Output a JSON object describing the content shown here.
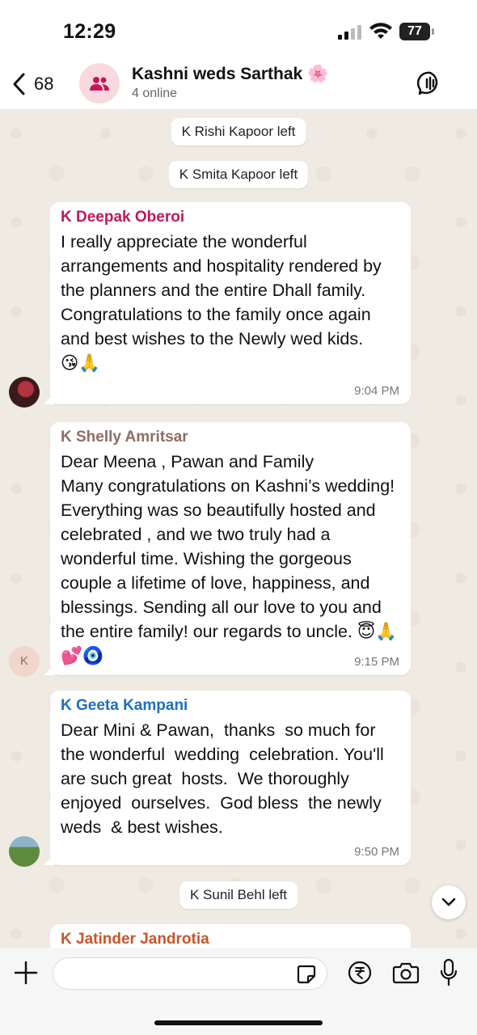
{
  "status_bar": {
    "time": "12:29",
    "battery": "77"
  },
  "header": {
    "back_count": "68",
    "title": "Kashni weds Sarthak 🌸",
    "subtitle": "4 online"
  },
  "chat": {
    "system_messages": [
      {
        "text": "K Rishi Kapoor left"
      },
      {
        "text": "K Smita Kapoor left"
      },
      {
        "text": "K Sunil Behl left"
      }
    ],
    "messages": [
      {
        "sender": "K Deepak Oberoi",
        "sender_color": "#c2185b",
        "text": "I really appreciate the wonderful arrangements and hospitality rendered by the planners and the entire Dhall family.\nCongratulations to the family once again and best wishes to the Newly wed kids.\n😘🙏",
        "time": "9:04 PM"
      },
      {
        "sender": "K Shelly Amritsar",
        "sender_color": "#8d6e63",
        "avatar_initial": "K",
        "text": "Dear Meena , Pawan and Family\nMany congratulations on Kashni’s wedding! Everything was so beautifully hosted and celebrated , and we two truly had a wonderful time. Wishing the gorgeous couple a lifetime of love, happiness, and blessings. Sending all our love to you and the entire family! our regards to uncle. 😇🙏💕🧿",
        "time": "9:15 PM"
      },
      {
        "sender": "K Geeta Kampani",
        "sender_color": "#1e6fc2",
        "text": "Dear Mini & Pawan,  thanks  so much for the wonderful  wedding  celebration. You'll are such great  hosts.  We thoroughly  enjoyed  ourselves.  God bless  the newly  weds  & best wishes.",
        "time": "9:50 PM"
      },
      {
        "sender": "K Jatinder Jandrotia",
        "sender_color": "#c8552a",
        "text": "",
        "time": ""
      }
    ]
  },
  "composer": {
    "placeholder": ""
  },
  "icons": {
    "back": "chevron-left-icon",
    "group": "group-icon",
    "call": "voice-chat-icon",
    "scroll": "chevron-down-icon",
    "plus": "plus-icon",
    "sticker": "sticker-icon",
    "payment": "rupee-icon",
    "camera": "camera-icon",
    "mic": "microphone-icon"
  }
}
